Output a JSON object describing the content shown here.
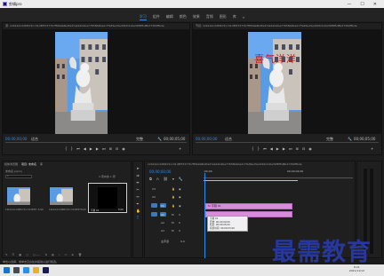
{
  "window": {
    "title": "剪辑pro"
  },
  "workspace_tabs": [
    {
      "label": "学习",
      "active": true
    },
    {
      "label": "组件",
      "active": false
    },
    {
      "label": "编辑",
      "active": false
    },
    {
      "label": "颜色",
      "active": false
    },
    {
      "label": "效果",
      "active": false
    },
    {
      "label": "音频",
      "active": false
    },
    {
      "label": "图形",
      "active": false
    },
    {
      "label": "库",
      "active": false
    }
  ],
  "workspace_more": "»",
  "source_monitor": {
    "header": "源: 12b1bdcdd6fb72cc31d8f37277b7ff0b9a6b2fa47abb1b2ba77658b40e2c7fa36e15a43bfcd10a39f8f5d8b27369ffbde",
    "timecode": "00;00;00;00",
    "fit": "适合",
    "quality": "完整",
    "duration": "00;00;05;00"
  },
  "program_monitor": {
    "header": "节目: 12b1bdcdd6fb72cc31d8f37277b7ff0b9a6b2fa47abb1b2ba77658b40e2c7fa36e15a43bfcd10a39f8f5d8b27369ffbde",
    "timecode": "00;00;00;00",
    "fit": "适合",
    "quality": "完整",
    "duration": "00;00;05;00",
    "overlay_text": "喜气洋洋"
  },
  "project": {
    "tabs": [
      "媒体浏览器",
      "项目: 未命名",
      "库"
    ],
    "active_tab": 1,
    "file": "未命名.prproj",
    "count": "3 项中的 1 项",
    "items": [
      {
        "name": "12b1bdcdd6fb72cc31d8f37...",
        "duration": "5:00"
      },
      {
        "name": "12b1bdcdd6fb72cc31d8f37...",
        "duration": "5:00"
      },
      {
        "name": "字幕 01",
        "duration": "5:00"
      }
    ]
  },
  "timeline": {
    "header": "12b1bdcdd6fb72cc31d8f37277b7ff0b9a6b2fa47abb1b2ba77658b40e2c7fa36e15a43bfcd10a39f8f5d8b27369ffbde",
    "timecode": "00;00;00;00",
    "ruler_start": ";00;00",
    "ruler_mid": "00;00;04;00",
    "tracks": [
      "V3",
      "V2",
      "V1",
      "A1",
      "A2",
      "A3"
    ],
    "master": "主声道",
    "master_value": "0.0",
    "clip_label": "字幕 01",
    "tooltip": {
      "name": "字幕 01",
      "start": "开始: 00;00;00;00",
      "end": "结束: 00;00;05;00",
      "duration": "持续时间: 00;00;05;00"
    }
  },
  "status_text": "单击以选择，或单击空白处并拖动以进行框选。",
  "clock": {
    "time": "8:21",
    "date": "2021/11/12"
  },
  "watermark": "最需教育",
  "colors": {
    "accent": "#2f8ae8",
    "clip": "#d78ed9",
    "watermark": "#27379e"
  }
}
